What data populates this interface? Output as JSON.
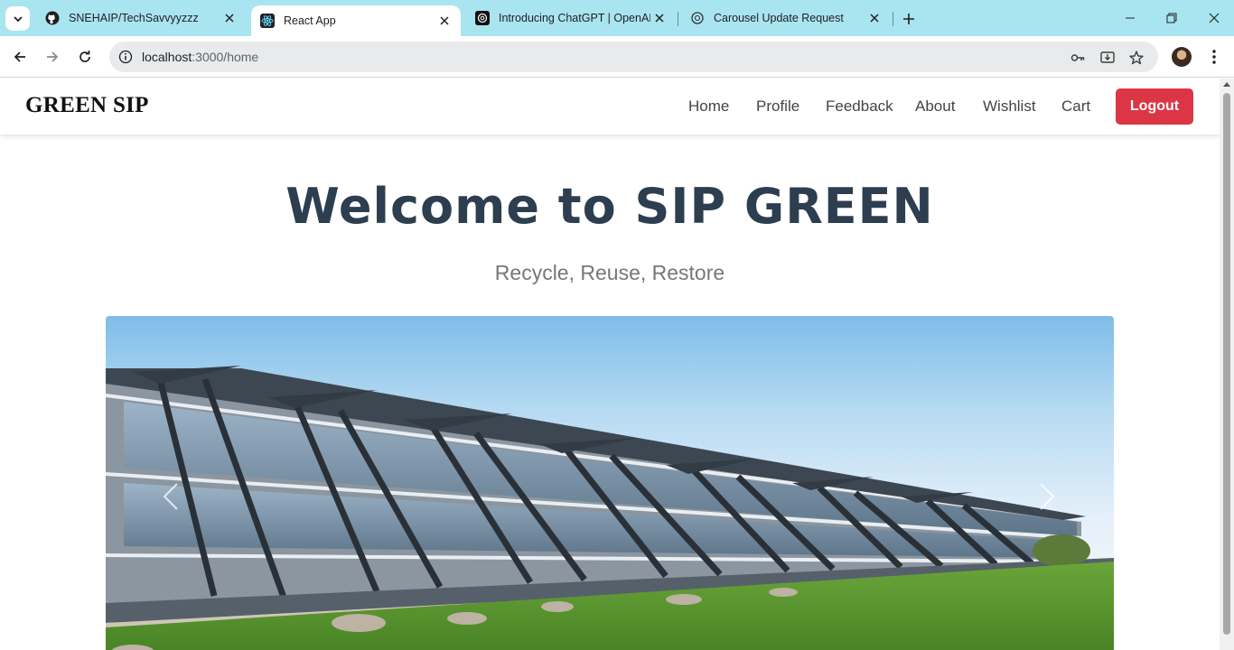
{
  "browser": {
    "tabs": [
      {
        "title": "SNEHAIP/TechSavvyyzzz",
        "icon": "github-icon",
        "active": false
      },
      {
        "title": "React App",
        "icon": "react-icon",
        "active": true
      },
      {
        "title": "Introducing ChatGPT | OpenAI",
        "icon": "openai-icon",
        "active": false
      },
      {
        "title": "Carousel Update Request",
        "icon": "chatgpt-icon",
        "active": false
      }
    ],
    "url_host": "localhost",
    "url_path": ":3000/home",
    "colors": {
      "tab_strip": "#a9e4f1",
      "omnibox": "#e9eaec"
    }
  },
  "navbar": {
    "brand": "GREEN SIP",
    "links": [
      "Home",
      "Profile",
      "Feedback",
      "About",
      "Wishlist",
      "Cart"
    ],
    "logout_label": "Logout",
    "logout_color": "#dc3545"
  },
  "hero": {
    "title": "Welcome to SIP GREEN",
    "subtitle": "Recycle, Reuse, Restore",
    "title_color": "#2c3e50"
  },
  "carousel": {
    "image": "modern glass building with green lawn",
    "prev_icon": "chevron-left-icon",
    "next_icon": "chevron-right-icon"
  }
}
